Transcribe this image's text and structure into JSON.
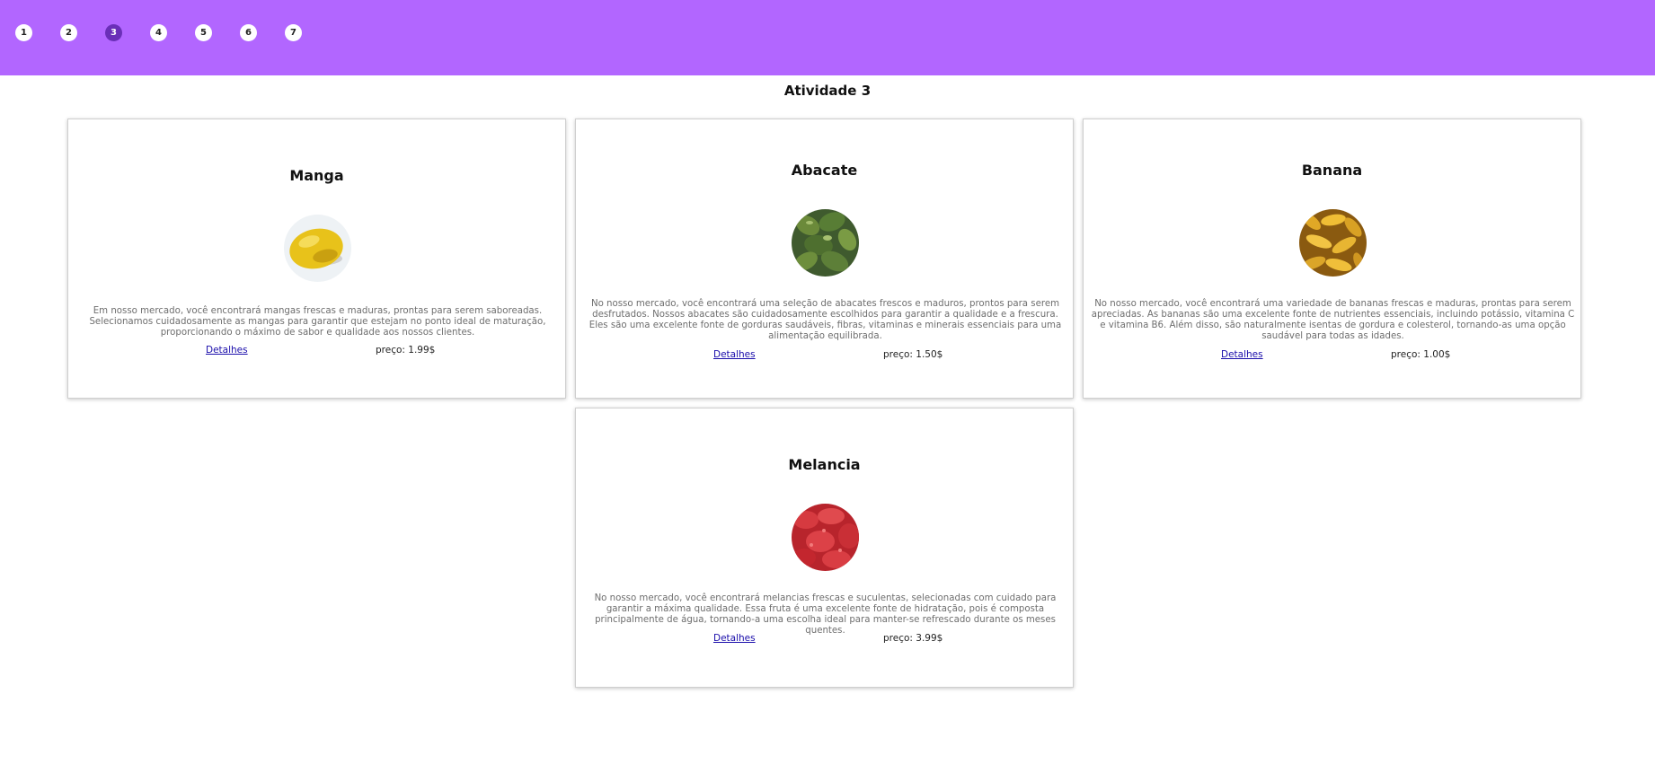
{
  "nav": {
    "steps": [
      "1",
      "2",
      "3",
      "4",
      "5",
      "6",
      "7"
    ],
    "active_step": "3",
    "bar_color": "#b266ff",
    "active_color": "#6a2fb8"
  },
  "page": {
    "title": "Atividade 3"
  },
  "products": [
    {
      "name": "Manga",
      "image": "mango-image",
      "description": "Em nosso mercado, você encontrará mangas frescas e maduras, prontas para serem saboreadas. Selecionamos cuidadosamente as mangas para garantir que estejam no ponto ideal de maturação, proporcionando o máximo de sabor e qualidade aos nossos clientes.",
      "details_label": "Detalhes",
      "price": "preço: 1.99$"
    },
    {
      "name": "Abacate",
      "image": "avocado-image",
      "description": "No nosso mercado, você encontrará uma seleção de abacates frescos e maduros, prontos para serem desfrutados. Nossos abacates são cuidadosamente escolhidos para garantir a qualidade e a frescura. Eles são uma excelente fonte de gorduras saudáveis, fibras, vitaminas e minerais essenciais para uma alimentação equilibrada.",
      "details_label": "Detalhes",
      "price": "preço: 1.50$"
    },
    {
      "name": "Banana",
      "image": "banana-image",
      "description": "No nosso mercado, você encontrará uma variedade de bananas frescas e maduras, prontas para serem apreciadas. As bananas são uma excelente fonte de nutrientes essenciais, incluindo potássio, vitamina C e vitamina B6. Além disso, são naturalmente isentas de gordura e colesterol, tornando-as uma opção saudável para todas as idades.",
      "details_label": "Detalhes",
      "price": "preço: 1.00$"
    },
    {
      "name": "Melancia",
      "image": "watermelon-image",
      "description": "No nosso mercado, você encontrará melancias frescas e suculentas, selecionadas com cuidado para garantir a máxima qualidade. Essa fruta é uma excelente fonte de hidratação, pois é composta principalmente de água, tornando-a uma escolha ideal para manter-se refrescado durante os meses quentes.",
      "details_label": "Detalhes",
      "price": "preço: 3.99$"
    }
  ]
}
